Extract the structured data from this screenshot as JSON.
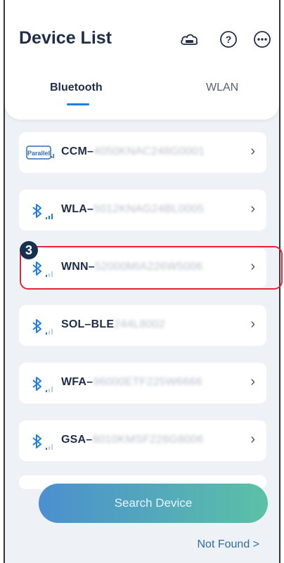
{
  "header": {
    "title": "Device List",
    "tabs": [
      {
        "label": "Bluetooth",
        "active": true
      },
      {
        "label": "WLAN",
        "active": false
      }
    ],
    "icons": [
      "cloud-sems-icon",
      "help-icon",
      "more-icon"
    ]
  },
  "devices": [
    {
      "prefix": "CCM–",
      "suffix": "4050KNAC248G0001",
      "icon": "parallel-icon"
    },
    {
      "prefix": "WLA–",
      "suffix": "5012KNAG24BL0005",
      "icon": "bluetooth-icon"
    },
    {
      "prefix": "WNN–",
      "suffix": "52000MIA226W5006",
      "icon": "bluetooth-icon"
    },
    {
      "prefix": "SOL–BLE",
      "suffix": "244L8002",
      "icon": "bluetooth-icon"
    },
    {
      "prefix": "WFA–",
      "suffix": "96000ETF225W6666",
      "icon": "bluetooth-icon"
    },
    {
      "prefix": "GSA–",
      "suffix": "8010KMSF226G8006",
      "icon": "bluetooth-icon"
    }
  ],
  "step_badge": "3",
  "buttons": {
    "search": "Search Device",
    "not_found": "Not Found >"
  },
  "colors": {
    "accent": "#1f7fe0",
    "highlight": "#e0263a",
    "text": "#1f2d48"
  }
}
